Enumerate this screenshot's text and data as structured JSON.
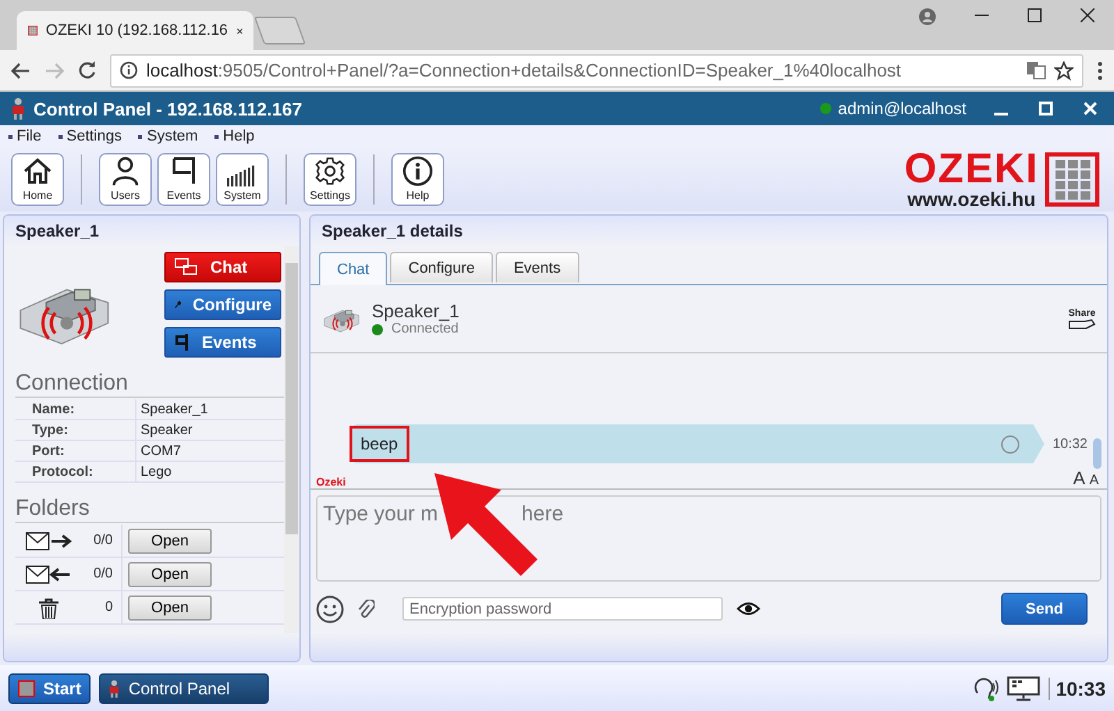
{
  "browser": {
    "tab": {
      "title": "OZEKI 10 (192.168.112.16"
    },
    "address": {
      "host": "localhost",
      "path": ":9505/Control+Panel/?a=Connection+details&ConnectionID=Speaker_1%40localhost"
    }
  },
  "app": {
    "title": "Control Panel - 192.168.112.167",
    "user": "admin@localhost",
    "online": true
  },
  "menu": [
    "File",
    "Settings",
    "System",
    "Help"
  ],
  "toolbar": [
    [
      {
        "label": "Home",
        "kind": "home"
      }
    ],
    [
      {
        "label": "Users",
        "kind": "user"
      },
      {
        "label": "Events",
        "kind": "flag"
      },
      {
        "label": "System",
        "kind": "bars"
      }
    ],
    [
      {
        "label": "Settings",
        "kind": "gear"
      }
    ],
    [
      {
        "label": "Help",
        "kind": "info"
      }
    ]
  ],
  "logo": {
    "name": "OZEKI",
    "url": "www.ozeki.hu"
  },
  "left_panel": {
    "title": "Speaker_1",
    "actions": [
      {
        "label": "Chat",
        "kind": "chat",
        "active": true
      },
      {
        "label": "Configure",
        "kind": "configure",
        "active": false
      },
      {
        "label": "Events",
        "kind": "events",
        "active": false
      }
    ],
    "connection": {
      "heading": "Connection",
      "rows": [
        {
          "label": "Name:",
          "value": "Speaker_1"
        },
        {
          "label": "Type:",
          "value": "Speaker"
        },
        {
          "label": "Port:",
          "value": "COM7"
        },
        {
          "label": "Protocol:",
          "value": "Lego"
        }
      ]
    },
    "folders": {
      "heading": "Folders",
      "rows": [
        {
          "kind": "outbox",
          "count": "0/0",
          "button": "Open"
        },
        {
          "kind": "inbox",
          "count": "0/0",
          "button": "Open"
        },
        {
          "kind": "trash",
          "count": "0",
          "button": "Open"
        }
      ]
    }
  },
  "details": {
    "title": "Speaker_1 details",
    "tabs": [
      {
        "label": "Chat",
        "selected": true
      },
      {
        "label": "Configure",
        "selected": false
      },
      {
        "label": "Events",
        "selected": false
      }
    ],
    "contact": {
      "name": "Speaker_1",
      "status": "Connected",
      "connected": true,
      "share": "Share"
    },
    "messages": [
      {
        "text": "beep",
        "time": "10:32",
        "highlighted": true
      }
    ],
    "brand": "Ozeki",
    "font_sizes": [
      "A",
      "A"
    ],
    "composer": {
      "placeholder_parts": [
        "Type your m",
        "here"
      ],
      "password_placeholder": "Encryption password",
      "send": "Send"
    }
  },
  "annotation": {
    "kind": "arrow"
  },
  "taskbar": {
    "start": "Start",
    "window": "Control Panel",
    "clock": "10:33"
  }
}
